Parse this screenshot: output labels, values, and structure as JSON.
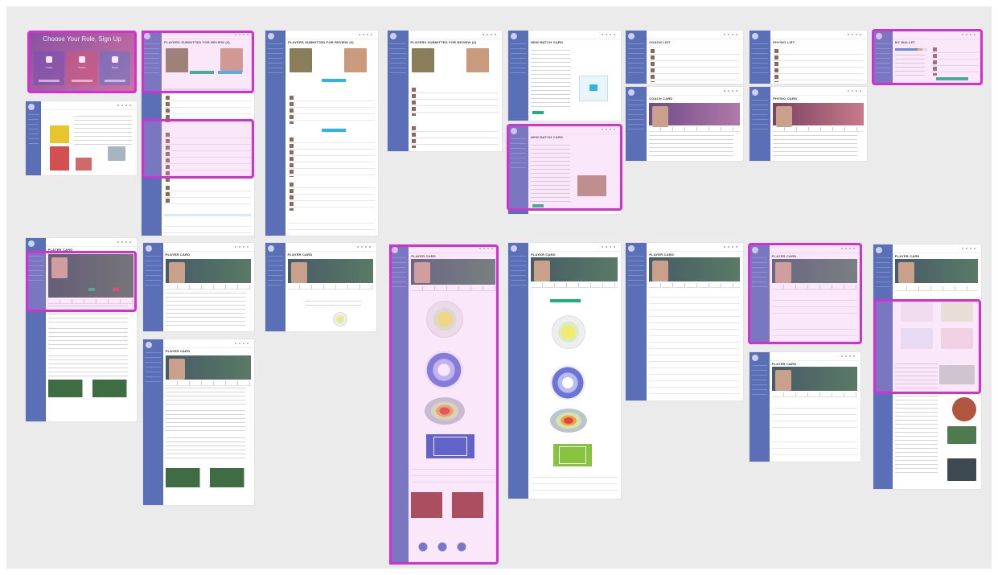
{
  "board": {
    "background": "#ebebeb",
    "highlight_color": "#d42fd0",
    "sidebar_color": "#5a6fb5"
  },
  "signup": {
    "title": "Choose Your Role, Sign Up",
    "subtitle": "",
    "roles": [
      "Coach",
      "Physio",
      "Player"
    ]
  },
  "frames": {
    "players_list_a": {
      "title": "PLAYERS SUBMITTED FOR REVIEW (3)"
    },
    "players_list_b": {
      "title": "PLAYERS SUBMITTED FOR REVIEW (3)"
    },
    "players_list_c": {
      "title": "PLAYERS SUBMITTED FOR REVIEW (3)"
    },
    "new_match_a": {
      "title": "NEW MATCH CARD"
    },
    "new_match_b": {
      "title": "NEW MATCH CARD"
    },
    "coach_list": {
      "title": "COACH LIST"
    },
    "physio_list": {
      "title": "PHYSIO LIST"
    },
    "my_wallet": {
      "title": "MY WALLET"
    },
    "coach_card": {
      "title": "COACH CARD"
    },
    "physio_card": {
      "title": "PHYSIO CARD"
    },
    "player_card_1": {
      "title": "PLAYER CARD"
    },
    "player_card_2": {
      "title": "PLAYER CARD"
    },
    "player_card_3": {
      "title": "PLAYER CARD"
    },
    "player_card_4": {
      "title": "PLAYER CARD"
    },
    "player_card_5": {
      "title": "PLAYER CARD"
    },
    "player_card_6": {
      "title": "PLAYER CARD"
    },
    "player_card_7": {
      "title": "PLAYER CARD"
    },
    "player_card_8": {
      "title": "PLAYER CARD"
    },
    "player_card_9": {
      "title": "PLAYER CARD"
    },
    "player_card_10": {
      "title": "PLAYER CARD"
    }
  }
}
